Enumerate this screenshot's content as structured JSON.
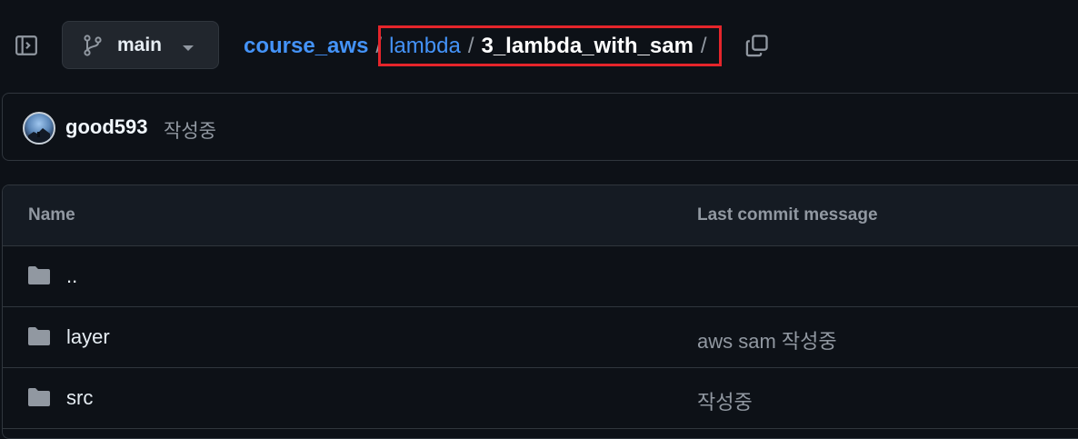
{
  "header": {
    "branch": {
      "label": "main"
    },
    "breadcrumb": {
      "root": "course_aws",
      "parent": "lambda",
      "current": "3_lambda_with_sam",
      "separator": "/"
    },
    "highlight_color": "#e5252b"
  },
  "commit": {
    "author": "good593",
    "message": "작성중"
  },
  "table": {
    "columns": {
      "name": "Name",
      "last_commit": "Last commit message"
    },
    "rows": [
      {
        "name": "..",
        "commit": "",
        "icon": "folder-icon"
      },
      {
        "name": "layer",
        "commit": "aws sam 작성중",
        "icon": "folder-icon"
      },
      {
        "name": "src",
        "commit": "작성중",
        "icon": "folder-icon"
      }
    ]
  },
  "colors": {
    "background": "#0d1117",
    "link": "#4493f8",
    "muted": "#9198a1",
    "border": "#30363d"
  }
}
